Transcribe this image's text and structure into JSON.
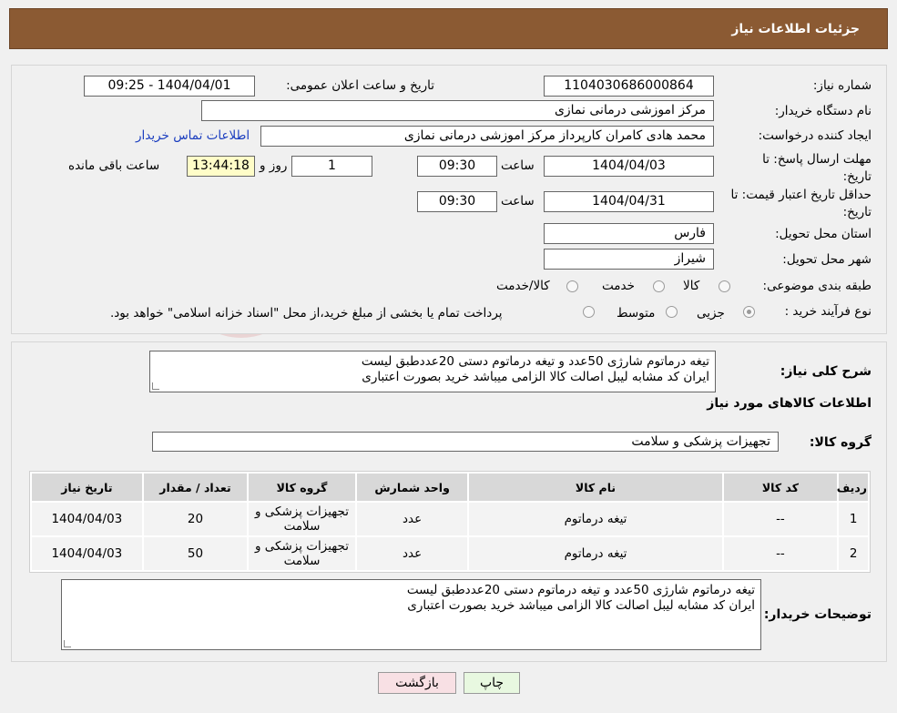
{
  "page": {
    "title": "جزئیات اطلاعات نیاز"
  },
  "need_info": {
    "need_number_label": "شماره نیاز:",
    "need_number": "1104030686000864",
    "announce_label": "تاریخ و ساعت اعلان عمومی:",
    "announce_value": "1404/04/01 - 09:25",
    "buyer_org_label": "نام دستگاه خریدار:",
    "buyer_org": "مرکز اموزشی درمانی نمازی",
    "creator_label": "ایجاد کننده درخواست:",
    "creator": "محمد هادی کامران کارپرداز مرکز اموزشی درمانی نمازی",
    "contact_link": "اطلاعات تماس خریدار",
    "deadline_label": "مهلت ارسال پاسخ: تا تاریخ:",
    "deadline_date": "1404/04/03",
    "time_label": "ساعت",
    "deadline_time": "09:30",
    "days_value": "1",
    "days_label": "روز و",
    "remaining_time": "13:44:18",
    "remaining_label": "ساعت باقی مانده",
    "validity_label": "حداقل تاریخ اعتبار قیمت: تا تاریخ:",
    "validity_date": "1404/04/31",
    "validity_time": "09:30",
    "province_label": "استان محل تحویل:",
    "province": "فارس",
    "city_label": "شهر محل تحویل:",
    "city": "شیراز",
    "category_label": "طبقه بندی موضوعی:",
    "category_options": [
      "کالا",
      "خدمت",
      "کالا/خدمت"
    ],
    "purchase_type_label": "نوع فرآیند خرید :",
    "purchase_options": [
      "جزیی",
      "متوسط"
    ],
    "purchase_note": "پرداخت تمام یا بخشی از مبلغ خرید،از محل \"اسناد خزانه اسلامی\" خواهد بود."
  },
  "description": {
    "label": "شرح کلی نیاز:",
    "line1": "تیغه درماتوم شارژی 50عدد و تیغه درماتوم دستی 20عددطبق لیست",
    "line2": "ایران کد مشابه  لیبل اصالت کالا الزامی میباشد خرید بصورت اعتباری"
  },
  "items_section": {
    "title": "اطلاعات کالاهای مورد نیاز",
    "group_label": "گروه کالا:",
    "group_value": "تجهیزات پزشکی و سلامت"
  },
  "table": {
    "headers": [
      "ردیف",
      "کد کالا",
      "نام کالا",
      "واحد شمارش",
      "گروه کالا",
      "تعداد / مقدار",
      "تاریخ نیاز"
    ],
    "rows": [
      [
        "1",
        "--",
        "تیغه درماتوم",
        "عدد",
        "تجهیزات پزشکی و سلامت",
        "20",
        "1404/04/03"
      ],
      [
        "2",
        "--",
        "تیغه درماتوم",
        "عدد",
        "تجهیزات پزشکی و سلامت",
        "50",
        "1404/04/03"
      ]
    ]
  },
  "buyer_notes": {
    "label": "توضیحات خریدار:",
    "line1": "تیغه درماتوم شارژی 50عدد و تیغه درماتوم دستی 20عددطبق لیست",
    "line2": "ایران کد مشابه  لیبل اصالت کالا الزامی میباشد خرید بصورت اعتباری"
  },
  "buttons": {
    "print": "چاپ",
    "back": "بازگشت"
  },
  "watermark": {
    "text": "AriaTender.neT"
  },
  "colors": {
    "header": "#8b5a33",
    "link": "#1a3dbf",
    "remaining_bg": "#fffdc8",
    "print_btn": "#e8f8e0",
    "back_btn": "#f8e0e4"
  }
}
